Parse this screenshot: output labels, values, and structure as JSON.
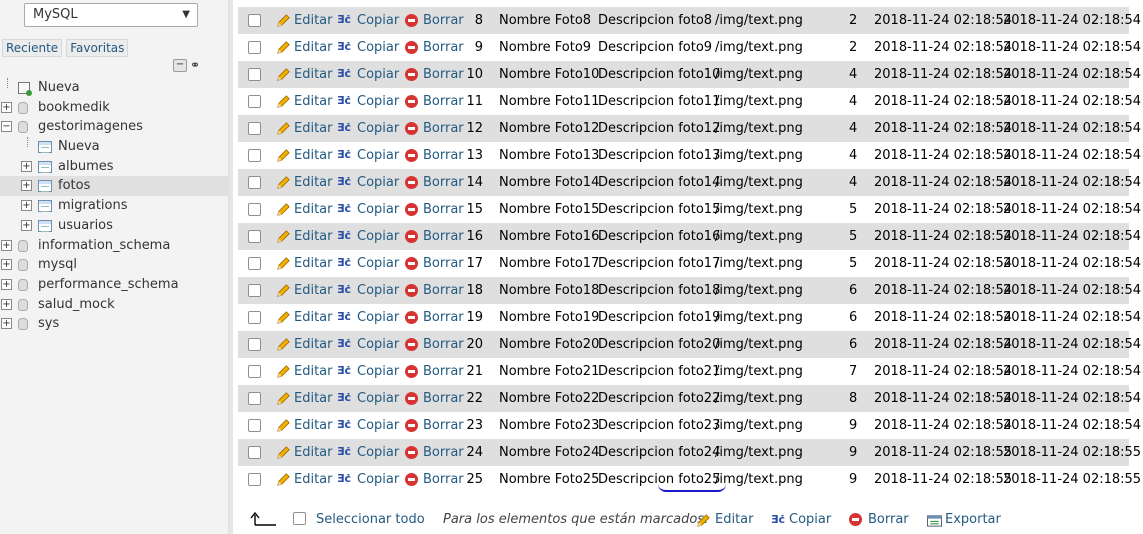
{
  "sidebar": {
    "server_select": "MySQL",
    "tabs": [
      "Reciente",
      "Favoritas"
    ],
    "tree": [
      {
        "label": "Nueva",
        "level": 0,
        "kind": "new"
      },
      {
        "label": "bookmedik",
        "level": 0,
        "kind": "db",
        "expander": "+"
      },
      {
        "label": "gestorimagenes",
        "level": 0,
        "kind": "db",
        "expander": "−"
      },
      {
        "label": "Nueva",
        "level": 1,
        "kind": "new-table"
      },
      {
        "label": "albumes",
        "level": 1,
        "kind": "table",
        "expander": "+"
      },
      {
        "label": "fotos",
        "level": 1,
        "kind": "table",
        "expander": "+",
        "active": true
      },
      {
        "label": "migrations",
        "level": 1,
        "kind": "table",
        "expander": "+"
      },
      {
        "label": "usuarios",
        "level": 1,
        "kind": "table",
        "expander": "+"
      },
      {
        "label": "information_schema",
        "level": 0,
        "kind": "db",
        "expander": "+"
      },
      {
        "label": "mysql",
        "level": 0,
        "kind": "db",
        "expander": "+"
      },
      {
        "label": "performance_schema",
        "level": 0,
        "kind": "db",
        "expander": "+"
      },
      {
        "label": "salud_mock",
        "level": 0,
        "kind": "db",
        "expander": "+"
      },
      {
        "label": "sys",
        "level": 0,
        "kind": "db",
        "expander": "+"
      }
    ]
  },
  "actions": {
    "edit": "Editar",
    "copy": "Copiar",
    "delete": "Borrar"
  },
  "rows": [
    {
      "id": "8",
      "nombre": "Nombre Foto8",
      "descripcion": "Descripcion foto8",
      "ruta": "/img/text.png",
      "album": "2",
      "created": "2018-11-24 02:18:54",
      "updated": "2018-11-24 02:18:54"
    },
    {
      "id": "9",
      "nombre": "Nombre Foto9",
      "descripcion": "Descripcion foto9",
      "ruta": "/img/text.png",
      "album": "2",
      "created": "2018-11-24 02:18:54",
      "updated": "2018-11-24 02:18:54"
    },
    {
      "id": "10",
      "nombre": "Nombre Foto10",
      "descripcion": "Descripcion foto10",
      "ruta": "/img/text.png",
      "album": "4",
      "created": "2018-11-24 02:18:54",
      "updated": "2018-11-24 02:18:54"
    },
    {
      "id": "11",
      "nombre": "Nombre Foto11",
      "descripcion": "Descripcion foto11",
      "ruta": "/img/text.png",
      "album": "4",
      "created": "2018-11-24 02:18:54",
      "updated": "2018-11-24 02:18:54"
    },
    {
      "id": "12",
      "nombre": "Nombre Foto12",
      "descripcion": "Descripcion foto12",
      "ruta": "/img/text.png",
      "album": "4",
      "created": "2018-11-24 02:18:54",
      "updated": "2018-11-24 02:18:54"
    },
    {
      "id": "13",
      "nombre": "Nombre Foto13",
      "descripcion": "Descripcion foto13",
      "ruta": "/img/text.png",
      "album": "4",
      "created": "2018-11-24 02:18:54",
      "updated": "2018-11-24 02:18:54"
    },
    {
      "id": "14",
      "nombre": "Nombre Foto14",
      "descripcion": "Descripcion foto14",
      "ruta": "/img/text.png",
      "album": "4",
      "created": "2018-11-24 02:18:54",
      "updated": "2018-11-24 02:18:54"
    },
    {
      "id": "15",
      "nombre": "Nombre Foto15",
      "descripcion": "Descripcion foto15",
      "ruta": "/img/text.png",
      "album": "5",
      "created": "2018-11-24 02:18:54",
      "updated": "2018-11-24 02:18:54"
    },
    {
      "id": "16",
      "nombre": "Nombre Foto16",
      "descripcion": "Descripcion foto16",
      "ruta": "/img/text.png",
      "album": "5",
      "created": "2018-11-24 02:18:54",
      "updated": "2018-11-24 02:18:54"
    },
    {
      "id": "17",
      "nombre": "Nombre Foto17",
      "descripcion": "Descripcion foto17",
      "ruta": "/img/text.png",
      "album": "5",
      "created": "2018-11-24 02:18:54",
      "updated": "2018-11-24 02:18:54"
    },
    {
      "id": "18",
      "nombre": "Nombre Foto18",
      "descripcion": "Descripcion foto18",
      "ruta": "/img/text.png",
      "album": "6",
      "created": "2018-11-24 02:18:54",
      "updated": "2018-11-24 02:18:54"
    },
    {
      "id": "19",
      "nombre": "Nombre Foto19",
      "descripcion": "Descripcion foto19",
      "ruta": "/img/text.png",
      "album": "6",
      "created": "2018-11-24 02:18:54",
      "updated": "2018-11-24 02:18:54"
    },
    {
      "id": "20",
      "nombre": "Nombre Foto20",
      "descripcion": "Descripcion foto20",
      "ruta": "/img/text.png",
      "album": "6",
      "created": "2018-11-24 02:18:54",
      "updated": "2018-11-24 02:18:54"
    },
    {
      "id": "21",
      "nombre": "Nombre Foto21",
      "descripcion": "Descripcion foto21",
      "ruta": "/img/text.png",
      "album": "7",
      "created": "2018-11-24 02:18:54",
      "updated": "2018-11-24 02:18:54"
    },
    {
      "id": "22",
      "nombre": "Nombre Foto22",
      "descripcion": "Descripcion foto22",
      "ruta": "/img/text.png",
      "album": "8",
      "created": "2018-11-24 02:18:54",
      "updated": "2018-11-24 02:18:54"
    },
    {
      "id": "23",
      "nombre": "Nombre Foto23",
      "descripcion": "Descripcion foto23",
      "ruta": "/img/text.png",
      "album": "9",
      "created": "2018-11-24 02:18:54",
      "updated": "2018-11-24 02:18:54"
    },
    {
      "id": "24",
      "nombre": "Nombre Foto24",
      "descripcion": "Descripcion foto24",
      "ruta": "/img/text.png",
      "album": "9",
      "created": "2018-11-24 02:18:55",
      "updated": "2018-11-24 02:18:55"
    },
    {
      "id": "25",
      "nombre": "Nombre Foto25",
      "descripcion": "Descripcion foto25",
      "ruta": "/img/text.png",
      "album": "9",
      "created": "2018-11-24 02:18:55",
      "updated": "2018-11-24 02:18:55"
    }
  ],
  "footer": {
    "select_all": "Seleccionar todo",
    "with_selected": "Para los elementos que están marcados:",
    "edit": "Editar",
    "copy": "Copiar",
    "delete": "Borrar",
    "export": "Exportar"
  },
  "colors": {
    "link": "#235a81",
    "row_alt": "#dfdfdf",
    "delete": "#d63333"
  }
}
